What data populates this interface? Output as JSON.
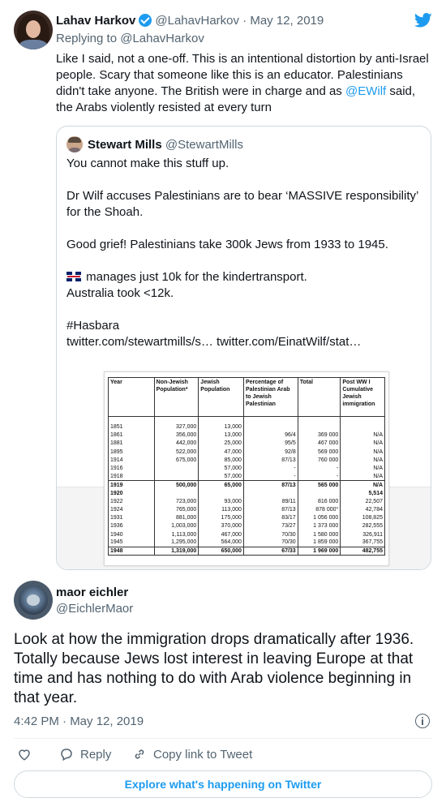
{
  "reply_tweet": {
    "author_name": "Lahav Harkov",
    "author_handle": "@LahavHarkov",
    "separator": "·",
    "date": "May 12, 2019",
    "replying_to": "Replying to @LahavHarkov",
    "text_before_mention": "Like I said, not a one-off. This is an intentional distortion by anti-Israel people. Scary that someone like this is an educator. Palestinians didn't take anyone. The British were in charge and as ",
    "mention": "@EWilf",
    "text_after_mention": " said, the Arabs violently resisted at every turn"
  },
  "quoted_tweet": {
    "author_name": "Stewart Mills",
    "author_handle": "@StewartMills",
    "line1": "You cannot make this stuff up.",
    "line2": "Dr Wilf accuses Palestinians are to bear ‘MASSIVE responsibility’ for the Shoah.",
    "line3": "Good grief! Palestinians take 300k Jews from 1933 to 1945.",
    "line4": "manages just 10k for the kindertransport.",
    "line5": "Australia took <12k.",
    "line6": "#Hasbara",
    "line7": "twitter.com/stewartmills/s… twitter.com/EinatWilf/stat…"
  },
  "table": {
    "headers": [
      "Year",
      "Non-Jewish Population*",
      "Jewish Population",
      "Percentage of Palestinian Arab to Jewish Palestinian",
      "Total",
      "Post WW I Cumulative Jewish immigration"
    ],
    "rows": [
      [
        "1851",
        "327,000",
        "13,000",
        "",
        "",
        ""
      ],
      [
        "1861",
        "356,000",
        "13,000",
        "96/4",
        "369 000",
        "N/A"
      ],
      [
        "1881",
        "442,000",
        "25,000",
        "95/5",
        "467 000",
        "N/A"
      ],
      [
        "1895",
        "522,000",
        "47,000",
        "92/8",
        "569 000",
        "N/A"
      ],
      [
        "1914",
        "675,000",
        "85,000",
        "87/13",
        "760 000",
        "N/A"
      ],
      [
        "1916",
        "",
        "57,000",
        "-",
        "-",
        "N/A"
      ],
      [
        "1918",
        "",
        "57,000",
        "-",
        "-",
        "N/A"
      ],
      [
        "1919",
        "500,000",
        "65,000",
        "87/13",
        "565 000",
        "N/A"
      ],
      [
        "1920",
        "",
        "",
        "",
        "",
        "5,514"
      ],
      [
        "1922",
        "723,000",
        "93,000",
        "89/11",
        "816 000",
        "22,507"
      ],
      [
        "1924",
        "765,000",
        "113,000",
        "87/13",
        "878 000°",
        "42,784"
      ],
      [
        "1931",
        "881,000",
        "175,000",
        "83/17",
        "1 056 000",
        "108,825"
      ],
      [
        "1936",
        "1,003,000",
        "370,000",
        "73/27",
        "1 373 000",
        "282,555"
      ],
      [
        "1940",
        "1,113,000",
        "467,000",
        "70/30",
        "1 580 000",
        "326,911"
      ],
      [
        "1945",
        "1,295,000",
        "564,000",
        "70/30",
        "1 859 000",
        "367,755"
      ],
      [
        "1948",
        "1,319,000",
        "650,000",
        "67/33",
        "1 969 000",
        "482,755"
      ]
    ]
  },
  "main_tweet": {
    "author_name": "maor eichler",
    "author_handle": "@EichlerMaor",
    "text": "Look at how the immigration drops dramatically after 1936. Totally because Jews lost interest in leaving Europe at that time and has nothing to do with Arab violence beginning in that year.",
    "timestamp": "4:42 PM · May 12, 2019"
  },
  "actions": {
    "like_icon": "heart-icon",
    "reply_label": "Reply",
    "copy_label": "Copy link to Tweet"
  },
  "explore_label": "Explore what's happening on Twitter",
  "colors": {
    "accent": "#1d9bf0",
    "text": "#0f1419",
    "secondary": "#536471",
    "border": "#cfd9de"
  }
}
